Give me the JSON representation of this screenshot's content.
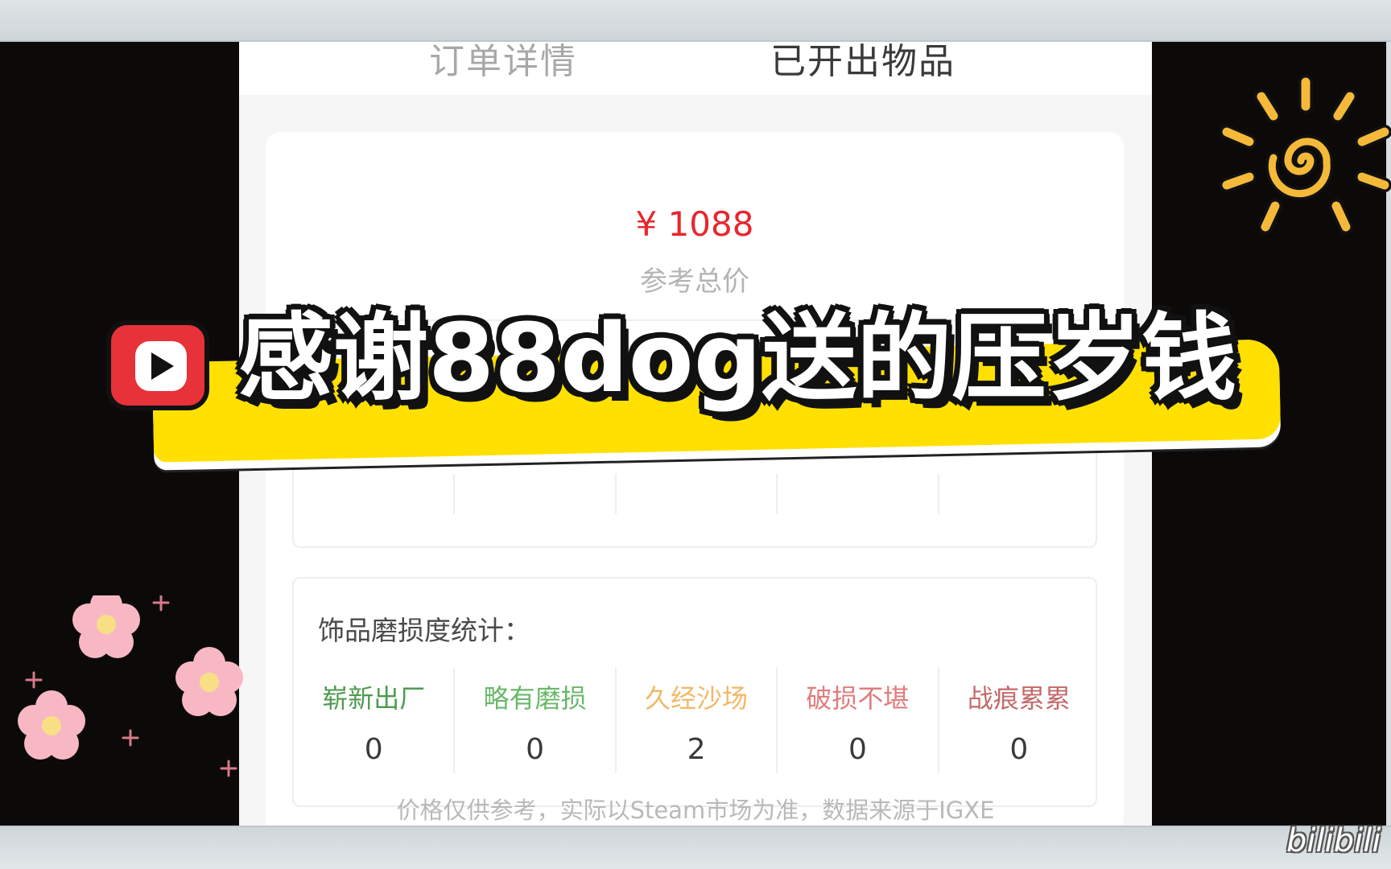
{
  "tabs": [
    "订单详情",
    "已开出物品"
  ],
  "summary": {
    "price": "¥ 1088",
    "price_label": "参考总价"
  },
  "wear_stats": {
    "title": "饰品磨损度统计：",
    "columns": [
      {
        "label": "崭新出厂",
        "value": "0",
        "color": "#4f9a4f"
      },
      {
        "label": "略有磨损",
        "value": "0",
        "color": "#6ab86a"
      },
      {
        "label": "久经沙场",
        "value": "2",
        "color": "#f1b868"
      },
      {
        "label": "破损不堪",
        "value": "0",
        "color": "#e07d7d"
      },
      {
        "label": "战痕累累",
        "value": "0",
        "color": "#c46a6a"
      }
    ]
  },
  "footnote": "价格仅供参考，实际以Steam市场为准，数据来源于IGXE",
  "banner": {
    "text": "感谢88dog送的压岁钱",
    "icon": "play-icon"
  },
  "decorations": [
    "sun-icon",
    "flower-icon"
  ],
  "watermark": "bilibili"
}
